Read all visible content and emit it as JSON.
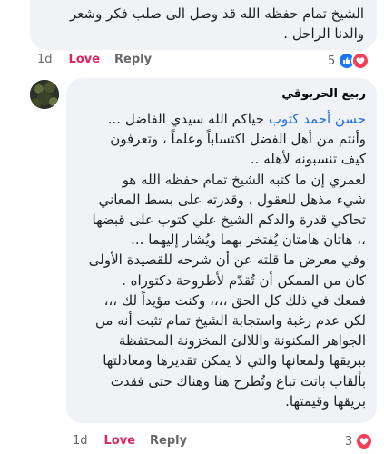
{
  "comment1": {
    "text": "الشيخ تمام حفظه الله قد وصل الى صلب فكر وشعر والدنا الراحل .",
    "time": "1d",
    "love": "Love",
    "reply": "Reply",
    "reaction_count": "5",
    "reaction_icons": [
      "like-icon",
      "heart-icon"
    ]
  },
  "comment2": {
    "author": "ربيع الحربوقي",
    "mention": "حسن أحمد كتوب",
    "line1_rest": " حياكم الله سيدي الفاضل ...",
    "lines": [
      "وأنتم من أهل الفضل اكتساباً وعلماً ، وتعرفون",
      "كيف تنسبونه لأهله ..",
      "لعمري إن ما كتبه الشيخ تمام حفظه الله هو",
      "شيء مذهل للعقول ، وقدرته على بسط المعاني",
      "تحاكي قدرة والدكم الشيخ علي كتوب على قبضها",
      "،، هاتان هامتان يُفتخر بهما ويُشار إليهما ...",
      "وفي معرض ما قلته عن أن شرحه للقصيدة الأولى",
      "كان من الممكن أن تُقدّم لأطروحة دكتوراه .",
      "فمعك في ذلك كل الحق ،،،، وكنت مؤيداً لك ،،،",
      "لكن عدم رغبة واستجابة الشيخ تمام تثبت أنه من",
      "الجواهر المكنونة واللالئ المخزونة المحتفظة",
      "ببريقها ولمعانها والتي لا يمكن تقديرها ومعادلتها",
      "بألقاب باتت تباع وتُطرح هنا وهناك حتى فقدت",
      "بريقها وقيمتها."
    ],
    "time": "1d",
    "love": "Love",
    "reply": "Reply",
    "reaction_count": "3",
    "reaction_icons": [
      "heart-icon"
    ]
  }
}
